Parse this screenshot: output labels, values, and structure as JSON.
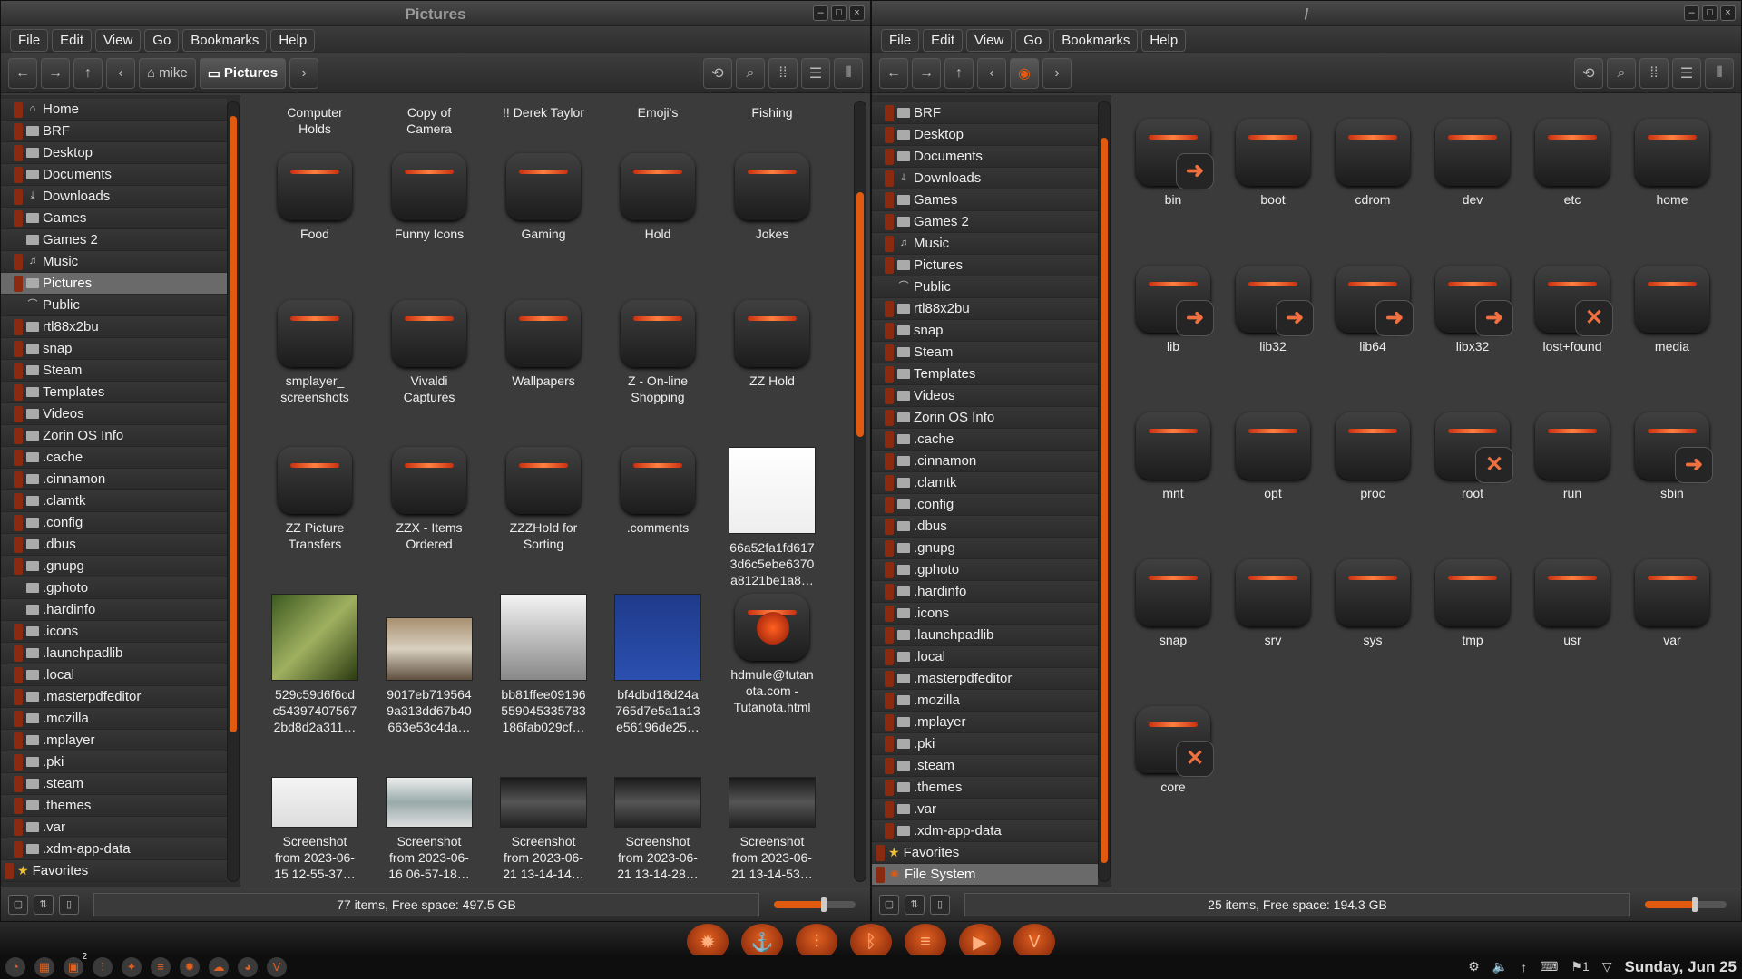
{
  "left_window": {
    "title": "Pictures",
    "menus": [
      "File",
      "Edit",
      "View",
      "Go",
      "Bookmarks",
      "Help"
    ],
    "breadcrumbs": [
      "mike",
      "Pictures"
    ],
    "sidebar": [
      {
        "label": "Home",
        "icon": "home-icon",
        "exp": true
      },
      {
        "label": "BRF",
        "icon": "folder-icon",
        "exp": true
      },
      {
        "label": "Desktop",
        "icon": "folder-icon",
        "exp": true
      },
      {
        "label": "Documents",
        "icon": "folder-icon",
        "exp": true
      },
      {
        "label": "Downloads",
        "icon": "download-folder-icon",
        "exp": true
      },
      {
        "label": "Games",
        "icon": "folder-icon",
        "exp": true
      },
      {
        "label": "Games 2",
        "icon": "folder-icon",
        "exp": false
      },
      {
        "label": "Music",
        "icon": "music-folder-icon",
        "exp": true
      },
      {
        "label": "Pictures",
        "icon": "pictures-folder-icon",
        "exp": true,
        "selected": true
      },
      {
        "label": "Public",
        "icon": "public-folder-icon",
        "exp": false
      },
      {
        "label": "rtl88x2bu",
        "icon": "folder-icon",
        "exp": true
      },
      {
        "label": "snap",
        "icon": "folder-icon",
        "exp": true
      },
      {
        "label": "Steam",
        "icon": "folder-icon",
        "exp": true
      },
      {
        "label": "Templates",
        "icon": "templates-folder-icon",
        "exp": true
      },
      {
        "label": "Videos",
        "icon": "video-folder-icon",
        "exp": true
      },
      {
        "label": "Zorin OS Info",
        "icon": "folder-icon",
        "exp": true
      },
      {
        "label": ".cache",
        "icon": "folder-icon",
        "exp": true
      },
      {
        "label": ".cinnamon",
        "icon": "folder-icon",
        "exp": true
      },
      {
        "label": ".clamtk",
        "icon": "folder-icon",
        "exp": true
      },
      {
        "label": ".config",
        "icon": "folder-icon",
        "exp": true
      },
      {
        "label": ".dbus",
        "icon": "folder-icon",
        "exp": true
      },
      {
        "label": ".gnupg",
        "icon": "folder-icon",
        "exp": true
      },
      {
        "label": ".gphoto",
        "icon": "folder-icon",
        "exp": false
      },
      {
        "label": ".hardinfo",
        "icon": "folder-icon",
        "exp": false
      },
      {
        "label": ".icons",
        "icon": "folder-icon",
        "exp": true
      },
      {
        "label": ".launchpadlib",
        "icon": "folder-icon",
        "exp": true
      },
      {
        "label": ".local",
        "icon": "folder-icon",
        "exp": true
      },
      {
        "label": ".masterpdfeditor",
        "icon": "folder-icon",
        "exp": true
      },
      {
        "label": ".mozilla",
        "icon": "folder-icon",
        "exp": true
      },
      {
        "label": ".mplayer",
        "icon": "folder-icon",
        "exp": true
      },
      {
        "label": ".pki",
        "icon": "folder-icon",
        "exp": true
      },
      {
        "label": ".steam",
        "icon": "folder-icon",
        "exp": true
      },
      {
        "label": ".themes",
        "icon": "folder-icon",
        "exp": true
      },
      {
        "label": ".var",
        "icon": "folder-icon",
        "exp": true
      },
      {
        "label": ".xdm-app-data",
        "icon": "folder-icon",
        "exp": true
      },
      {
        "label": "Favorites",
        "icon": "star-icon",
        "exp": true,
        "root": true
      }
    ],
    "files": [
      {
        "name": "Computer\nHolds",
        "kind": "partial"
      },
      {
        "name": "Copy of\nCamera",
        "kind": "partial"
      },
      {
        "name": "!! Derek Taylor",
        "kind": "partial"
      },
      {
        "name": "Emoji's",
        "kind": "partial"
      },
      {
        "name": "Fishing",
        "kind": "partial"
      },
      {
        "name": "Food",
        "kind": "folder"
      },
      {
        "name": "Funny Icons",
        "kind": "folder"
      },
      {
        "name": "Gaming",
        "kind": "folder"
      },
      {
        "name": "Hold",
        "kind": "folder"
      },
      {
        "name": "Jokes",
        "kind": "folder"
      },
      {
        "name": "smplayer_\nscreenshots",
        "kind": "folder"
      },
      {
        "name": "Vivaldi\nCaptures",
        "kind": "folder"
      },
      {
        "name": "Wallpapers",
        "kind": "folder"
      },
      {
        "name": "Z - On-line\nShopping",
        "kind": "folder"
      },
      {
        "name": "ZZ Hold",
        "kind": "folder"
      },
      {
        "name": "ZZ Picture\nTransfers",
        "kind": "folder"
      },
      {
        "name": "ZZX - Items\nOrdered",
        "kind": "folder"
      },
      {
        "name": "ZZZHold for\nSorting",
        "kind": "folder"
      },
      {
        "name": ".comments",
        "kind": "folder"
      },
      {
        "name": "66a52fa1fd617\n3d6c5ebe6370\na8121be1a8…",
        "kind": "thumb-doc"
      },
      {
        "name": "529c59d6f6cd\nc54397407567\n2bd8d2a311…",
        "kind": "thumb-green"
      },
      {
        "name": "9017eb719564\n9a313dd67b40\n663e53c4da…",
        "kind": "thumb-sign"
      },
      {
        "name": "bb81ffee09196\n559045335783\n186fab029cf…",
        "kind": "thumb-comic"
      },
      {
        "name": "bf4dbd18d24a\n765d7e5a1a13\ne56196de25…",
        "kind": "thumb-blue"
      },
      {
        "name": "hdmule@tutan\nota.com -\nTutanota.html",
        "kind": "html"
      },
      {
        "name": "Screenshot\nfrom 2023-06-\n15 12-55-37…",
        "kind": "thumb-shot"
      },
      {
        "name": "Screenshot\nfrom 2023-06-\n16 06-57-18…",
        "kind": "thumb-shot2"
      },
      {
        "name": "Screenshot\nfrom 2023-06-\n21 13-14-14…",
        "kind": "thumb-dark"
      },
      {
        "name": "Screenshot\nfrom 2023-06-\n21 13-14-28…",
        "kind": "thumb-dark"
      },
      {
        "name": "Screenshot\nfrom 2023-06-\n21 13-14-53…",
        "kind": "thumb-dark"
      }
    ],
    "status": "77 items, Free space: 497.5 GB"
  },
  "right_window": {
    "title": "/",
    "menus": [
      "File",
      "Edit",
      "View",
      "Go",
      "Bookmarks",
      "Help"
    ],
    "sidebar": [
      {
        "label": "BRF",
        "icon": "folder-icon",
        "exp": true
      },
      {
        "label": "Desktop",
        "icon": "folder-icon",
        "exp": true
      },
      {
        "label": "Documents",
        "icon": "folder-icon",
        "exp": true
      },
      {
        "label": "Downloads",
        "icon": "download-folder-icon",
        "exp": true
      },
      {
        "label": "Games",
        "icon": "folder-icon",
        "exp": true
      },
      {
        "label": "Games 2",
        "icon": "folder-icon",
        "exp": true
      },
      {
        "label": "Music",
        "icon": "music-folder-icon",
        "exp": true
      },
      {
        "label": "Pictures",
        "icon": "pictures-folder-icon",
        "exp": true
      },
      {
        "label": "Public",
        "icon": "public-folder-icon",
        "exp": false
      },
      {
        "label": "rtl88x2bu",
        "icon": "folder-icon",
        "exp": true
      },
      {
        "label": "snap",
        "icon": "folder-icon",
        "exp": true
      },
      {
        "label": "Steam",
        "icon": "folder-icon",
        "exp": true
      },
      {
        "label": "Templates",
        "icon": "templates-folder-icon",
        "exp": true
      },
      {
        "label": "Videos",
        "icon": "video-folder-icon",
        "exp": true
      },
      {
        "label": "Zorin OS Info",
        "icon": "folder-icon",
        "exp": true
      },
      {
        "label": ".cache",
        "icon": "folder-icon",
        "exp": true
      },
      {
        "label": ".cinnamon",
        "icon": "folder-icon",
        "exp": true
      },
      {
        "label": ".clamtk",
        "icon": "folder-icon",
        "exp": true
      },
      {
        "label": ".config",
        "icon": "folder-icon",
        "exp": true
      },
      {
        "label": ".dbus",
        "icon": "folder-icon",
        "exp": true
      },
      {
        "label": ".gnupg",
        "icon": "folder-icon",
        "exp": true
      },
      {
        "label": ".gphoto",
        "icon": "folder-icon",
        "exp": true
      },
      {
        "label": ".hardinfo",
        "icon": "folder-icon",
        "exp": true
      },
      {
        "label": ".icons",
        "icon": "folder-icon",
        "exp": true
      },
      {
        "label": ".launchpadlib",
        "icon": "folder-icon",
        "exp": true
      },
      {
        "label": ".local",
        "icon": "folder-icon",
        "exp": true
      },
      {
        "label": ".masterpdfeditor",
        "icon": "folder-icon",
        "exp": true
      },
      {
        "label": ".mozilla",
        "icon": "folder-icon",
        "exp": true
      },
      {
        "label": ".mplayer",
        "icon": "folder-icon",
        "exp": true
      },
      {
        "label": ".pki",
        "icon": "folder-icon",
        "exp": true
      },
      {
        "label": ".steam",
        "icon": "folder-icon",
        "exp": true
      },
      {
        "label": ".themes",
        "icon": "folder-icon",
        "exp": true
      },
      {
        "label": ".var",
        "icon": "folder-icon",
        "exp": true
      },
      {
        "label": ".xdm-app-data",
        "icon": "folder-icon",
        "exp": true
      },
      {
        "label": "Favorites",
        "icon": "star-icon",
        "exp": true,
        "root": true
      },
      {
        "label": "File System",
        "icon": "disk-icon",
        "exp": true,
        "root": true,
        "selected": true
      }
    ],
    "files": [
      {
        "name": "bin",
        "badge": "link"
      },
      {
        "name": "boot"
      },
      {
        "name": "cdrom"
      },
      {
        "name": "dev"
      },
      {
        "name": "etc"
      },
      {
        "name": "home"
      },
      {
        "name": "lib",
        "badge": "link"
      },
      {
        "name": "lib32",
        "badge": "link"
      },
      {
        "name": "lib64",
        "badge": "link"
      },
      {
        "name": "libx32",
        "badge": "link"
      },
      {
        "name": "lost+found",
        "badge": "x"
      },
      {
        "name": "media"
      },
      {
        "name": "mnt"
      },
      {
        "name": "opt"
      },
      {
        "name": "proc"
      },
      {
        "name": "root",
        "badge": "x"
      },
      {
        "name": "run"
      },
      {
        "name": "sbin",
        "badge": "link"
      },
      {
        "name": "snap"
      },
      {
        "name": "srv"
      },
      {
        "name": "sys"
      },
      {
        "name": "tmp"
      },
      {
        "name": "usr"
      },
      {
        "name": "var"
      },
      {
        "name": "core",
        "badge": "x",
        "file": true
      }
    ],
    "status": "25 items, Free space: 194.3 GB"
  },
  "taskbar": {
    "clock": "Sunday, Jun 25",
    "badge_count": "2",
    "tray_count": "1"
  },
  "colors": {
    "accent": "#e05a10",
    "window_bg": "#3b3b3b",
    "sidebar_bg": "#2d2d2d"
  }
}
